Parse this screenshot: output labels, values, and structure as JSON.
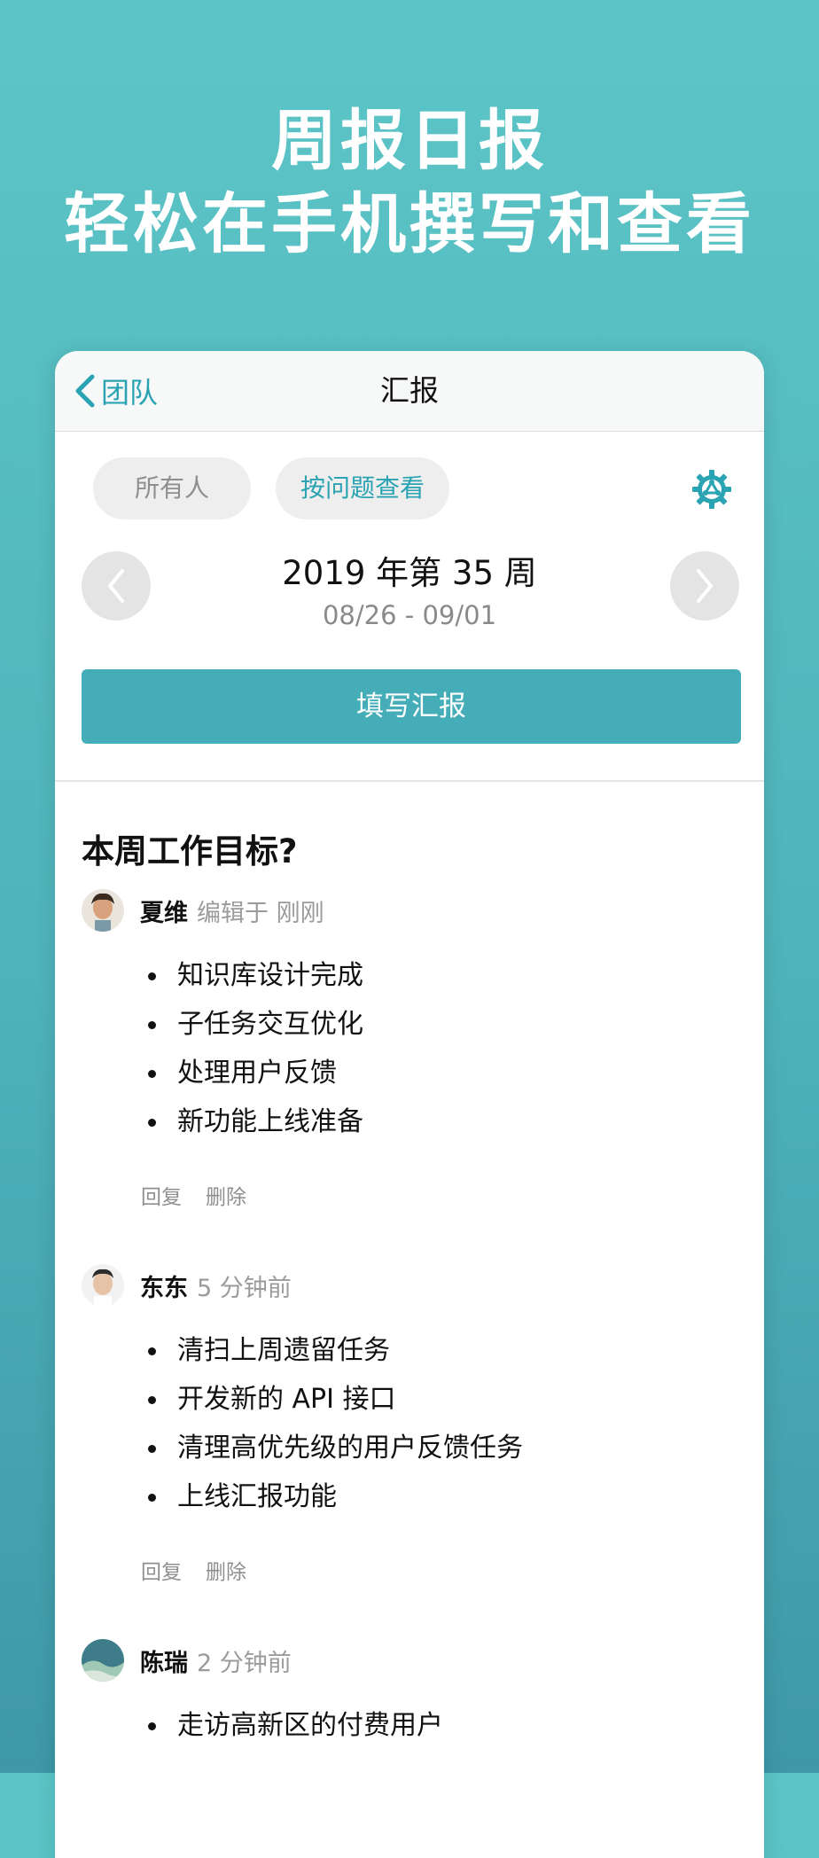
{
  "promo": {
    "line1": "周报日报",
    "line2": "轻松在手机撰写和查看"
  },
  "navbar": {
    "back_label": "团队",
    "title": "汇报"
  },
  "filters": {
    "all_label": "所有人",
    "by_question_label": "按问题查看"
  },
  "week": {
    "title": "2019 年第 35 周",
    "range": "08/26 - 09/01"
  },
  "submit_label": "填写汇报",
  "question": "本周工作目标?",
  "entries": [
    {
      "author": "夏维",
      "meta": "编辑于 刚刚",
      "items": [
        "知识库设计完成",
        "子任务交互优化",
        "处理用户反馈",
        "新功能上线准备"
      ],
      "reply_label": "回复",
      "delete_label": "删除"
    },
    {
      "author": "东东",
      "meta": "5 分钟前",
      "items": [
        "清扫上周遗留任务",
        "开发新的 API 接口",
        "清理高优先级的用户反馈任务",
        "上线汇报功能"
      ],
      "reply_label": "回复",
      "delete_label": "删除"
    },
    {
      "author": "陈瑞",
      "meta": "2 分钟前",
      "items": [
        "走访高新区的付费用户"
      ]
    }
  ],
  "colors": {
    "accent": "#2aa3b2",
    "button": "#44adb8",
    "background_top": "#5cc5c7",
    "background_bottom": "#3e98a7"
  },
  "icons": {
    "back": "chevron-left-icon",
    "settings": "gear-icon",
    "prev": "chevron-left-icon",
    "next": "chevron-right-icon"
  }
}
